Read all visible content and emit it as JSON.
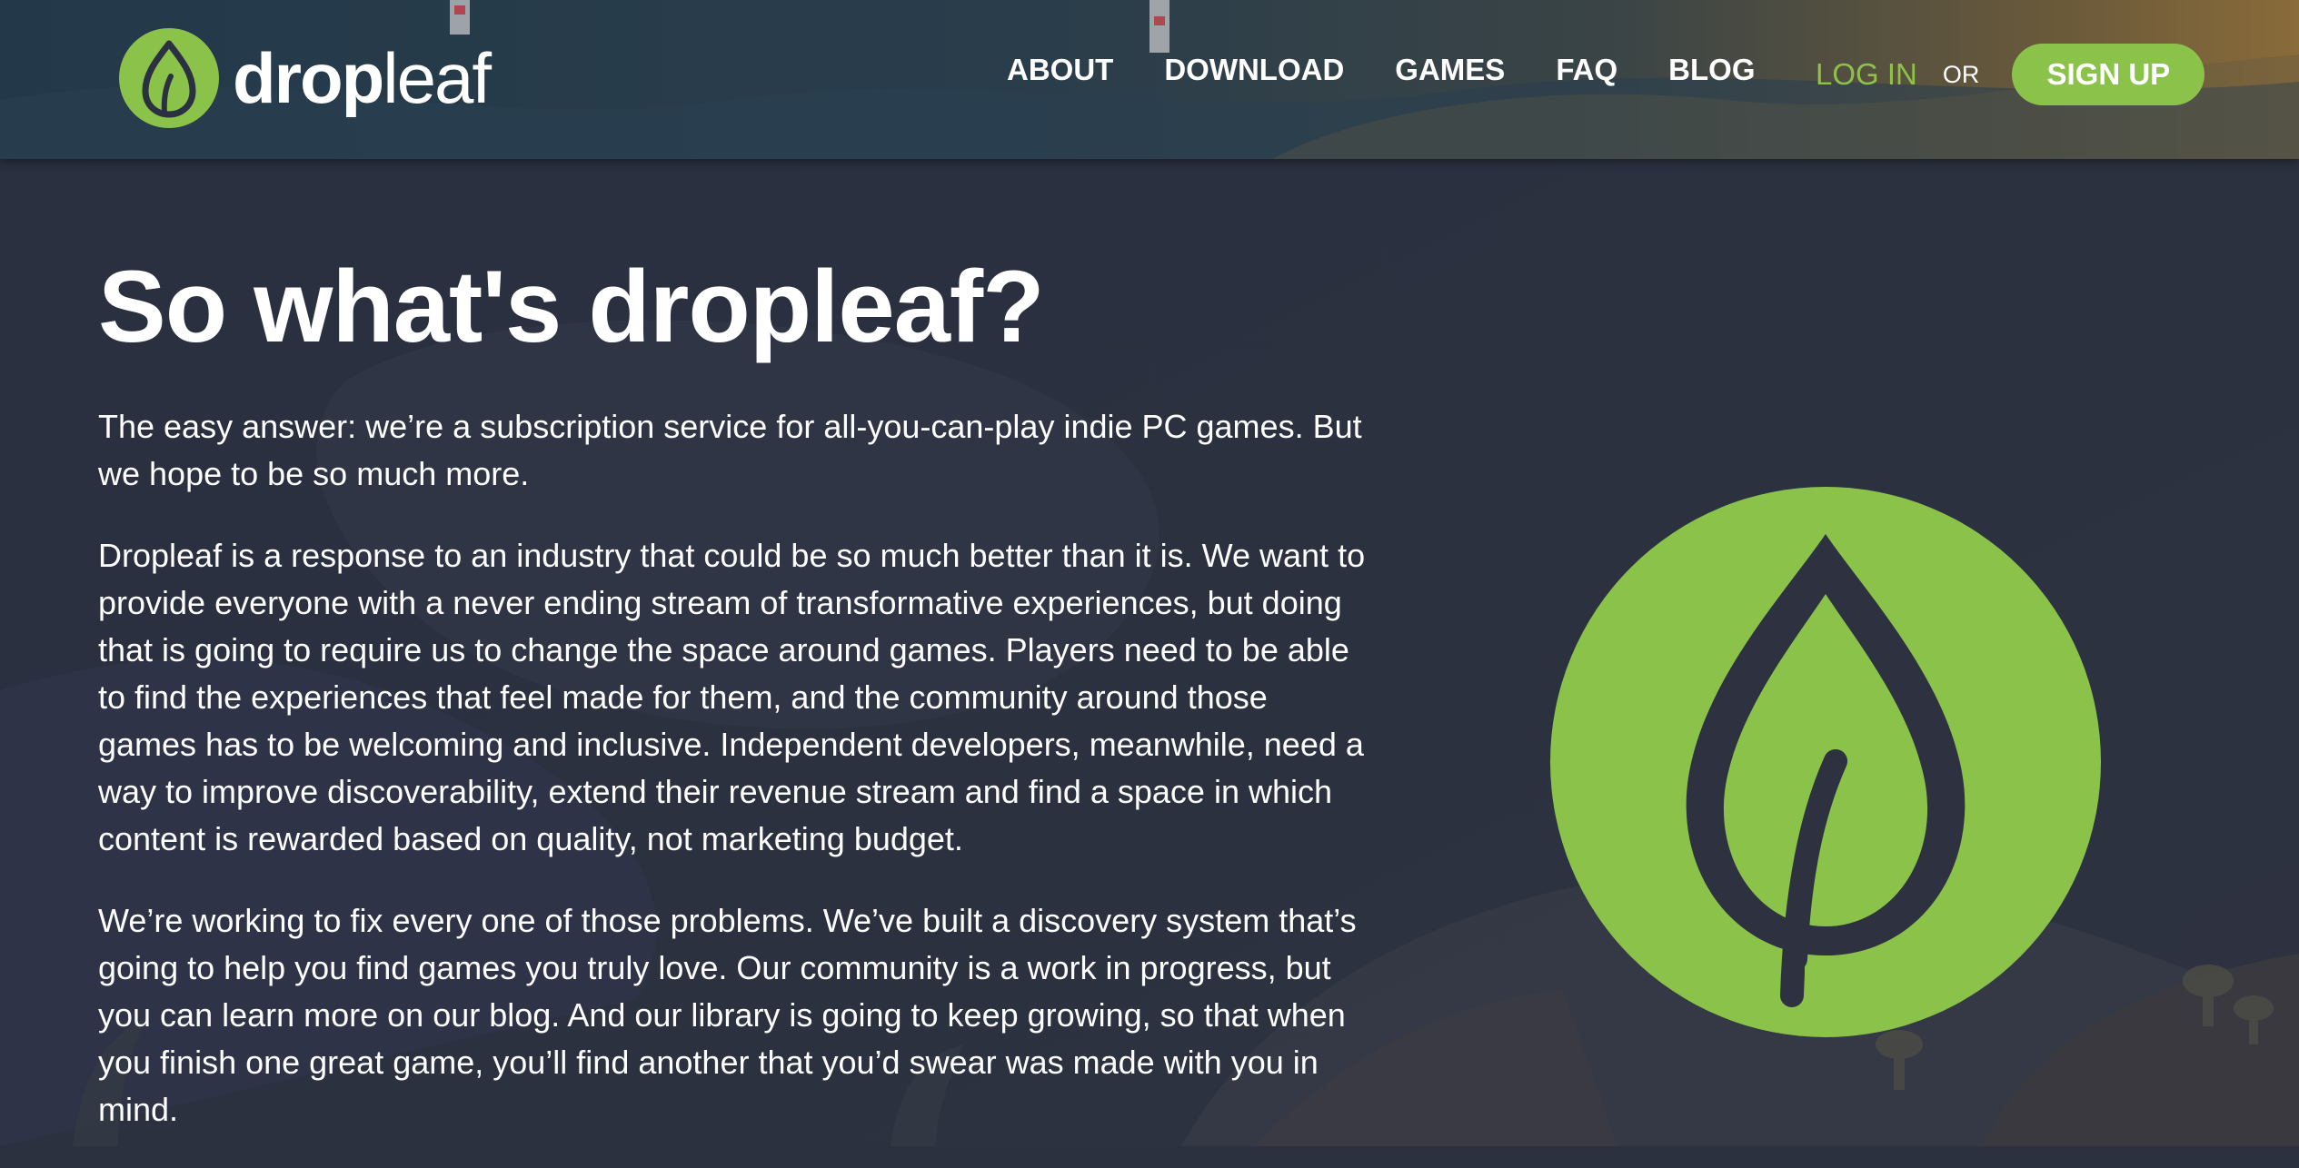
{
  "brand": {
    "name_bold": "drop",
    "name_light": "leaf",
    "accent_color": "#8bc34a",
    "dark_color": "#2c3140"
  },
  "nav": {
    "items": [
      {
        "label": "ABOUT"
      },
      {
        "label": "DOWNLOAD"
      },
      {
        "label": "GAMES"
      },
      {
        "label": "FAQ"
      },
      {
        "label": "BLOG"
      }
    ],
    "login_label": "LOG IN",
    "or_label": "OR",
    "signup_label": "SIGN UP"
  },
  "main": {
    "title": "So what's dropleaf?",
    "paragraphs": [
      "The easy answer: we’re a subscription service for all-you-can-play indie PC games. But we hope to be so much more.",
      "Dropleaf is a response to an industry that could be so much better than it is. We want to provide everyone with a never ending stream of transformative experiences, but doing that is going to require us to change the space around games. Players need to be able to find the experiences that feel made for them, and the community around those games has to be welcoming and inclusive. Independent developers, meanwhile, need a way to improve discoverability, extend their revenue stream and find a space in which content is rewarded based on quality, not marketing budget.",
      "We’re working to fix every one of those problems. We’ve built a discovery system that’s going to help you find games you truly love. Our community is a work in progress, but you can learn more on our blog. And our library is going to keep growing, so that when you finish one great game, you’ll find another that you’d swear was made with you in mind."
    ]
  },
  "icons": {
    "logo": "leaf-logo-icon",
    "hero": "leaf-emblem-icon"
  }
}
